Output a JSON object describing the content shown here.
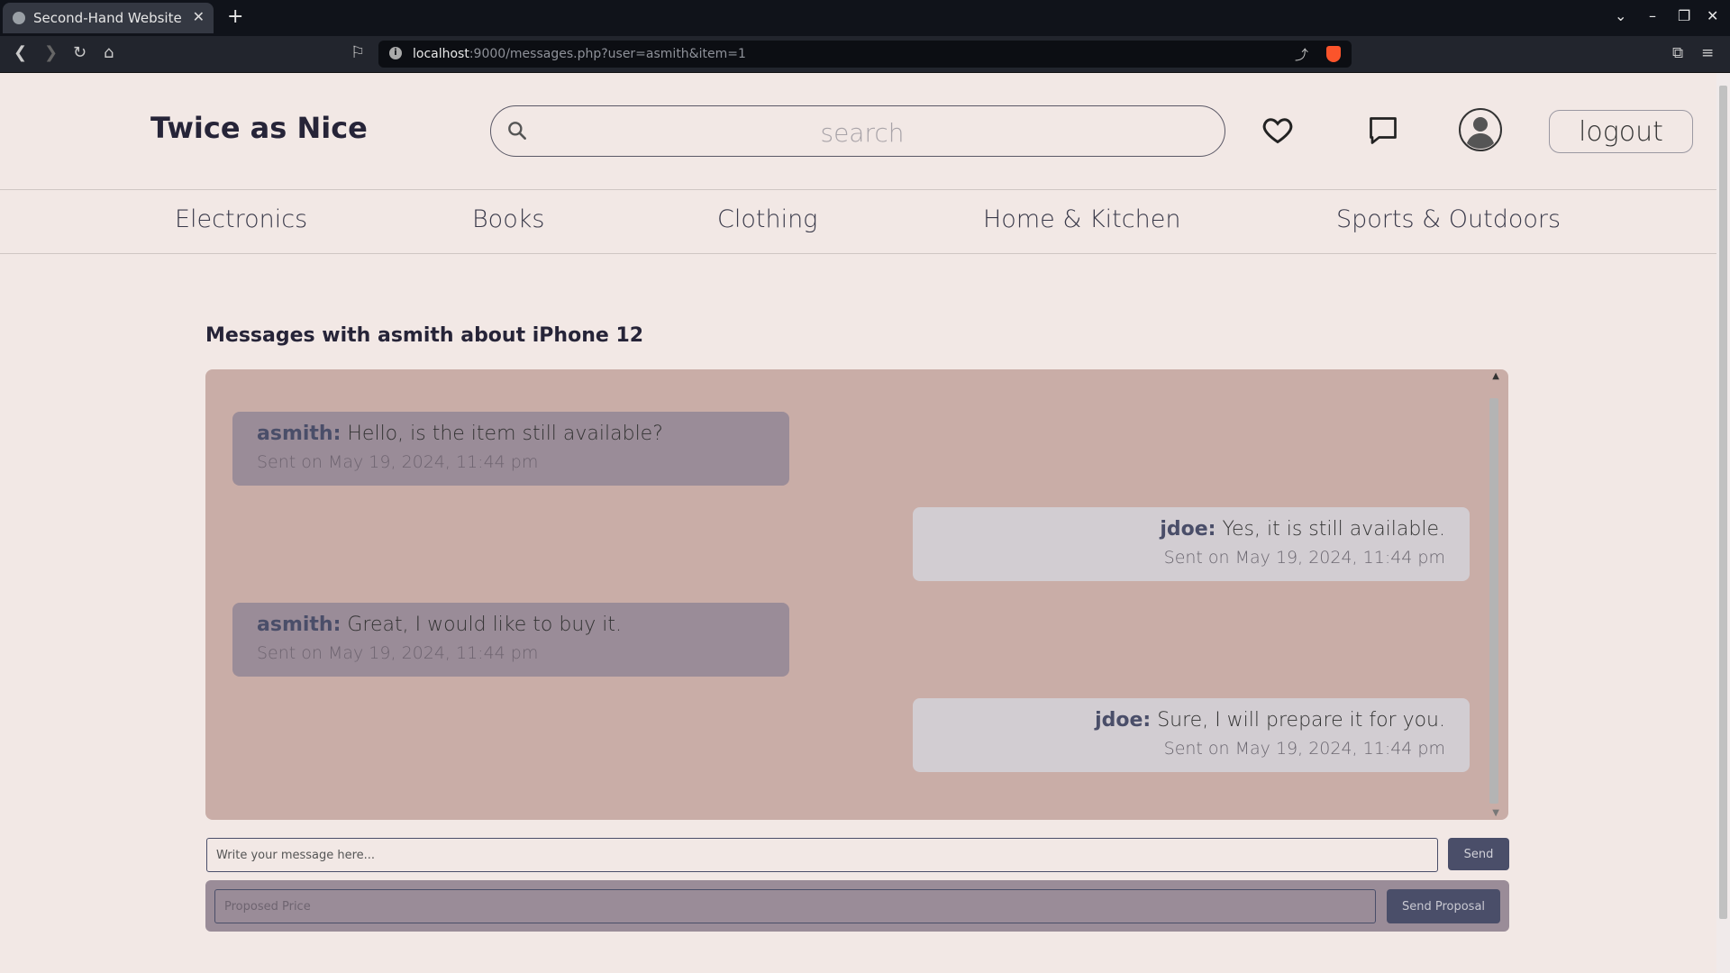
{
  "browser": {
    "tab_title": "Second-Hand Website",
    "tab_close": "✕",
    "new_tab": "+",
    "url_host": "localhost",
    "url_rest": ":9000/messages.php?user=asmith&item=1"
  },
  "header": {
    "logo": "Twice as Nice",
    "search_placeholder": "search",
    "logout_label": "logout"
  },
  "categories": [
    "Electronics",
    "Books",
    "Clothing",
    "Home & Kitchen",
    "Sports & Outdoors"
  ],
  "chat": {
    "title": "Messages with asmith about iPhone 12",
    "messages": [
      {
        "sender": "asmith:",
        "text": " Hello, is the item still available?",
        "time": "Sent on May 19, 2024, 11:44 pm"
      },
      {
        "sender": "jdoe:",
        "text": " Yes, it is still available.",
        "time": "Sent on May 19, 2024, 11:44 pm"
      },
      {
        "sender": "asmith:",
        "text": " Great, I would like to buy it.",
        "time": "Sent on May 19, 2024, 11:44 pm"
      },
      {
        "sender": "jdoe:",
        "text": " Sure, I will prepare it for you.",
        "time": "Sent on May 19, 2024, 11:44 pm"
      }
    ]
  },
  "composer": {
    "message_placeholder": "Write your message here...",
    "send_label": "Send",
    "price_placeholder": "Proposed Price",
    "proposal_label": "Send Proposal"
  },
  "colors": {
    "page_bg": "#f2e8e5",
    "chat_bg": "#c9ada7",
    "other_bubble": "#9a8c98",
    "my_bubble": "#d2cdd2",
    "accent": "#4a4e69"
  }
}
